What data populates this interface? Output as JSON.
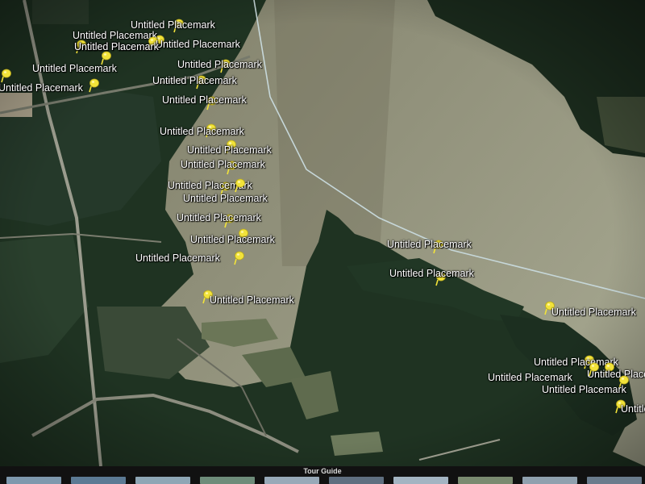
{
  "map": {
    "placemarks": [
      {
        "label": "Untitled Placemark"
      },
      {
        "label": "Untitled Placemark"
      },
      {
        "label": "Untitled Placemark"
      },
      {
        "label": "Untitled Placemark"
      },
      {
        "label": "Untitled Placemark"
      },
      {
        "label": "Untitled Placemark"
      },
      {
        "label": "Untitled Placemark"
      },
      {
        "label": "Untitled Placemark"
      },
      {
        "label": "Untitled Placemark"
      },
      {
        "label": "Untitled Placemark"
      },
      {
        "label": "Untitled Placemark"
      },
      {
        "label": "Untitled Placemark"
      },
      {
        "label": "Untitled Placemark"
      },
      {
        "label": "Untitled Placemark"
      },
      {
        "label": "Untitled Placemark"
      },
      {
        "label": "Untitled Placemark"
      },
      {
        "label": "Untitled Placemark"
      },
      {
        "label": "Untitled Placemark"
      },
      {
        "label": "Untitled Placemark"
      },
      {
        "label": "Untitled Placemark"
      },
      {
        "label": "Untitled Placemark"
      },
      {
        "label": "Untitled Placemark"
      },
      {
        "label": "Untitled Placemark"
      },
      {
        "label": "Untitled Placemark"
      },
      {
        "label": "Untitled Placemark"
      },
      {
        "label": "Untitled Placemark"
      },
      {
        "label": "Untitled Placemark"
      }
    ],
    "pin_color": "#f2e33a",
    "water_color": "#8a8a72",
    "forest_color": "#1f3322"
  },
  "tour_guide": {
    "title": "Tour Guide"
  }
}
